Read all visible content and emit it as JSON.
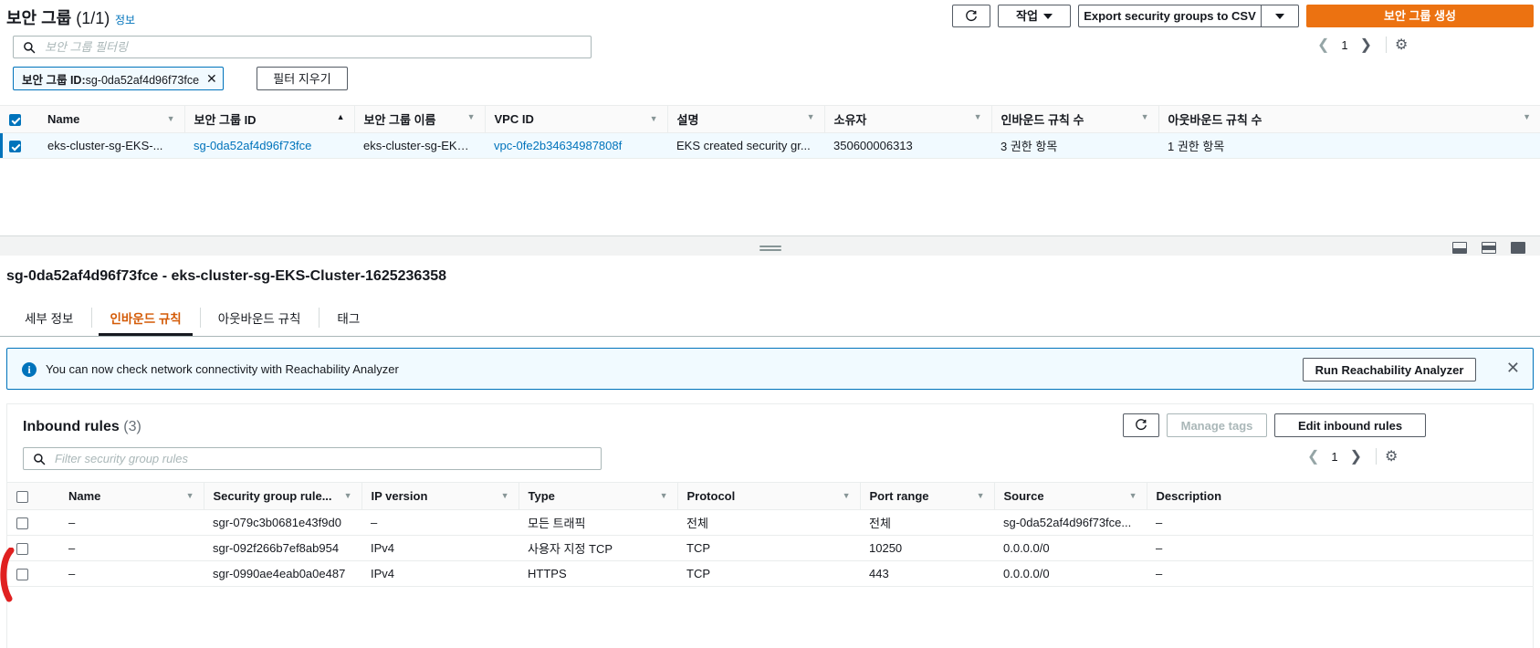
{
  "top": {
    "title": "보안 그룹",
    "count": "(1/1)",
    "info_link": "정보",
    "search_placeholder": "보안 그룹 필터링",
    "search_value": "",
    "filter_token_label": "보안 그룹 ID:",
    "filter_token_value": "sg-0da52af4d96f73fce",
    "clear_filters_label": "필터 지우기",
    "toolbar": {
      "refresh_icon": "refresh-icon",
      "actions_label": "작업",
      "export_label": "Export security groups to CSV",
      "export_caret_icon": "chevron-down-icon",
      "create_label": "보안 그룹 생성"
    },
    "pager": {
      "prev_icon": "chevron-left-icon",
      "page": "1",
      "next_icon": "chevron-right-icon",
      "settings_icon": "gear-icon"
    }
  },
  "sg_table": {
    "columns": [
      {
        "label": "Name",
        "sort": "desc-inactive"
      },
      {
        "label": "보안 그룹 ID",
        "sort": "asc-active"
      },
      {
        "label": "보안 그룹 이름",
        "sort": "desc-inactive"
      },
      {
        "label": "VPC ID",
        "sort": "desc-inactive"
      },
      {
        "label": "설명",
        "sort": "desc-inactive"
      },
      {
        "label": "소유자",
        "sort": "desc-inactive"
      },
      {
        "label": "인바운드 규칙 수",
        "sort": "desc-inactive"
      },
      {
        "label": "아웃바운드 규칙 수",
        "sort": "none"
      }
    ],
    "rows": [
      {
        "selected": true,
        "name": "eks-cluster-sg-EKS-...",
        "group_id": "sg-0da52af4d96f73fce",
        "group_name": "eks-cluster-sg-EKS-Clu...",
        "vpc_id": "vpc-0fe2b34634987808f",
        "description": "EKS created security gr...",
        "owner": "350600006313",
        "inbound_count": "3 권한 항목",
        "outbound_count": "1 권한 항목"
      }
    ]
  },
  "splitter": {
    "grip_icon": "drag-handle-icon",
    "panel_icons": [
      "panel-bottom-icon",
      "panel-side-icon",
      "panel-full-icon"
    ]
  },
  "detail": {
    "title": "sg-0da52af4d96f73fce - eks-cluster-sg-EKS-Cluster-1625236358",
    "tabs": [
      {
        "label": "세부 정보",
        "active": false
      },
      {
        "label": "인바운드 규칙",
        "active": true
      },
      {
        "label": "아웃바운드 규칙",
        "active": false
      },
      {
        "label": "태그",
        "active": false
      }
    ]
  },
  "banner": {
    "icon": "info-icon",
    "icon_glyph": "i",
    "text": "You can now check network connectivity with Reachability Analyzer",
    "button_label": "Run Reachability Analyzer",
    "close_icon": "close-icon",
    "border_color": "#0073bb",
    "background_color": "#f1faff"
  },
  "inbound": {
    "title": "Inbound rules",
    "count": "(3)",
    "refresh_icon": "refresh-icon",
    "manage_tags_label": "Manage tags",
    "manage_tags_disabled": true,
    "edit_label": "Edit inbound rules",
    "search_placeholder": "Filter security group rules",
    "search_value": "",
    "pager": {
      "prev_icon": "chevron-left-icon",
      "page": "1",
      "next_icon": "chevron-right-icon",
      "settings_icon": "gear-icon"
    },
    "columns": [
      {
        "label": "Name",
        "sort": "desc-inactive"
      },
      {
        "label": "Security group rule...",
        "sort": "desc-inactive"
      },
      {
        "label": "IP version",
        "sort": "desc-inactive"
      },
      {
        "label": "Type",
        "sort": "desc-inactive"
      },
      {
        "label": "Protocol",
        "sort": "desc-inactive"
      },
      {
        "label": "Port range",
        "sort": "desc-inactive"
      },
      {
        "label": "Source",
        "sort": "desc-inactive"
      },
      {
        "label": "Description",
        "sort": "none"
      }
    ],
    "rows": [
      {
        "name": "–",
        "rule_id": "sgr-079c3b0681e43f9d0",
        "ip_version": "–",
        "type": "모든 트래픽",
        "protocol": "전체",
        "port_range": "전체",
        "source": "sg-0da52af4d96f73fce...",
        "description": "–"
      },
      {
        "name": "–",
        "rule_id": "sgr-092f266b7ef8ab954",
        "ip_version": "IPv4",
        "type": "사용자 지정 TCP",
        "protocol": "TCP",
        "port_range": "10250",
        "source": "0.0.0.0/0",
        "description": "–"
      },
      {
        "name": "–",
        "rule_id": "sgr-0990ae4eab0a0e487",
        "ip_version": "IPv4",
        "type": "HTTPS",
        "protocol": "TCP",
        "port_range": "443",
        "source": "0.0.0.0/0",
        "description": "–"
      }
    ]
  },
  "annotation": {
    "shape": "red-arc-highlight",
    "color": "#e02020"
  },
  "theme": {
    "accent_orange": "#ec7211",
    "link_blue": "#0073bb",
    "selected_row": "#f1faff"
  }
}
